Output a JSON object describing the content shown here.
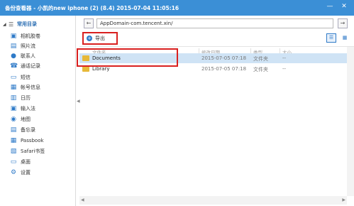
{
  "window": {
    "title": "备份查看器 - 小凯的new iphone (2) (8.4) 2015-07-04 11:05:16",
    "minimize_glyph": "—",
    "close_glyph": "✕"
  },
  "sidebar": {
    "group_label": "常用目录",
    "items": [
      {
        "label": "相机胶卷",
        "icon": "camera-roll-icon",
        "color": "#2e7ac8"
      },
      {
        "label": "照片流",
        "icon": "photo-stream-icon",
        "color": "#2e7ac8"
      },
      {
        "label": "联系人",
        "icon": "contacts-icon",
        "color": "#2e7ac8"
      },
      {
        "label": "通话记录",
        "icon": "call-log-icon",
        "color": "#2e7ac8"
      },
      {
        "label": "短信",
        "icon": "sms-icon",
        "color": "#2e7ac8"
      },
      {
        "label": "帐号信息",
        "icon": "account-icon",
        "color": "#2e7ac8"
      },
      {
        "label": "日历",
        "icon": "calendar-icon",
        "color": "#2e7ac8"
      },
      {
        "label": "输入法",
        "icon": "keyboard-icon",
        "color": "#2e7ac8"
      },
      {
        "label": "地图",
        "icon": "map-pin-icon",
        "color": "#2e7ac8"
      },
      {
        "label": "备忘录",
        "icon": "memo-icon",
        "color": "#2e7ac8"
      },
      {
        "label": "Passbook",
        "icon": "passbook-icon",
        "color": "#2e7ac8"
      },
      {
        "label": "Safari书签",
        "icon": "bookmark-icon",
        "color": "#2e7ac8"
      },
      {
        "label": "桌面",
        "icon": "desktop-icon",
        "color": "#2e7ac8"
      },
      {
        "label": "设置",
        "icon": "gear-icon",
        "color": "#2e7ac8"
      }
    ]
  },
  "address_bar": {
    "path": "AppDomain-com.tencent.xin/",
    "back_glyph": "←",
    "go_glyph": "→"
  },
  "toolbar": {
    "export_label": "导出"
  },
  "columns": {
    "name": "文件名",
    "modified": "修改日期",
    "type": "类型",
    "size": "大小"
  },
  "rows": [
    {
      "name": "Documents",
      "modified": "2015-07-05 07:18",
      "type": "文件夹",
      "size": "--",
      "selected": true
    },
    {
      "name": "Library",
      "modified": "2015-07-05 07:18",
      "type": "文件夹",
      "size": "--",
      "selected": false
    }
  ],
  "colors": {
    "titlebar": "#3b8fd6",
    "selection": "#cfe3f5",
    "annotation_red": "#d9201f",
    "folder": "#e7b93a",
    "accent": "#2e7ac8"
  }
}
